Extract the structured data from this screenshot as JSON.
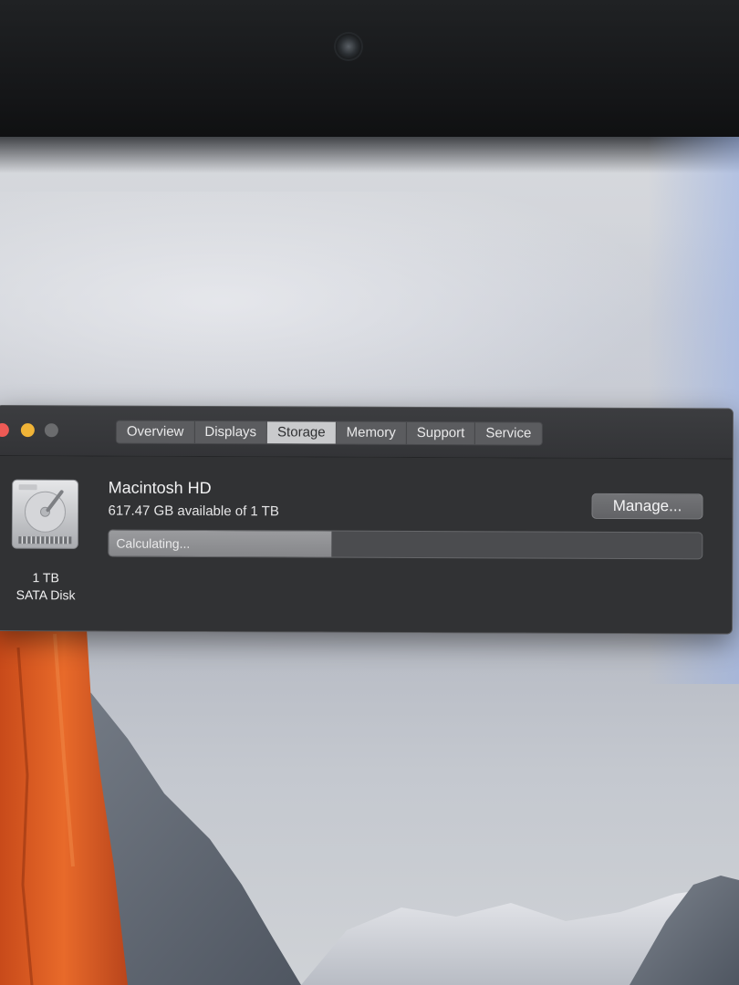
{
  "window": {
    "tabs": [
      {
        "label": "Overview"
      },
      {
        "label": "Displays"
      },
      {
        "label": "Storage"
      },
      {
        "label": "Memory"
      },
      {
        "label": "Support"
      },
      {
        "label": "Service"
      }
    ],
    "active_tab": "Storage"
  },
  "storage": {
    "disk_icon": "hard-drive-icon",
    "disk_capacity": "1 TB",
    "disk_type": "SATA Disk",
    "volume_name": "Macintosh HD",
    "available_text": "617.47 GB available of 1 TB",
    "manage_label": "Manage...",
    "bar_label": "Calculating...",
    "bar_fill_fraction": 0.375
  },
  "colors": {
    "close": "#ed5a55",
    "minimize": "#f0b437",
    "zoom_inactive": "#6b6c6e",
    "window_bg": "#313234",
    "active_tab_bg": "#c9cacc"
  }
}
